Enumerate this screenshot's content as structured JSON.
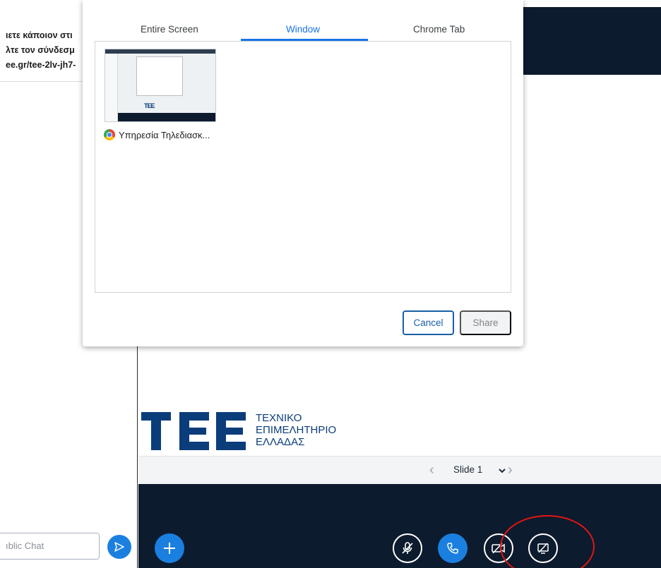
{
  "chat": {
    "welcome_lines": [
      "ιετε κάποιον στι",
      "λτε τον σύνδεσμ",
      "ee.gr/tee-2lv-jh7-"
    ],
    "input_placeholder": "ıblic Chat"
  },
  "share_dialog": {
    "tabs": [
      {
        "label": "Entire Screen",
        "active": false
      },
      {
        "label": "Window",
        "active": true
      },
      {
        "label": "Chrome Tab",
        "active": false
      }
    ],
    "windows": [
      {
        "title": "Υπηρεσία Τηλεδιασκ...",
        "icon": "chrome-icon"
      }
    ],
    "cancel_label": "Cancel",
    "share_label": "Share"
  },
  "presentation": {
    "logo_text": "TEE",
    "org_lines": [
      "ΤΕΧΝΙΚΟ",
      "ΕΠΙΜΕΛΗΤΗΡΙΟ",
      "ΕΛΛΑΔΑΣ"
    ],
    "slide_label": "Slide 1"
  },
  "colors": {
    "accent": "#1a73e8",
    "bbb_blue": "#1b7fe0",
    "dark_bar": "#0c1b2d",
    "highlight_ring": "#e01616"
  },
  "icons": {
    "send": "send-icon",
    "plus": "plus-icon",
    "mute": "microphone-muted-icon",
    "phone": "phone-icon",
    "camera": "video-off-icon",
    "screenshare": "screenshare-off-icon"
  }
}
